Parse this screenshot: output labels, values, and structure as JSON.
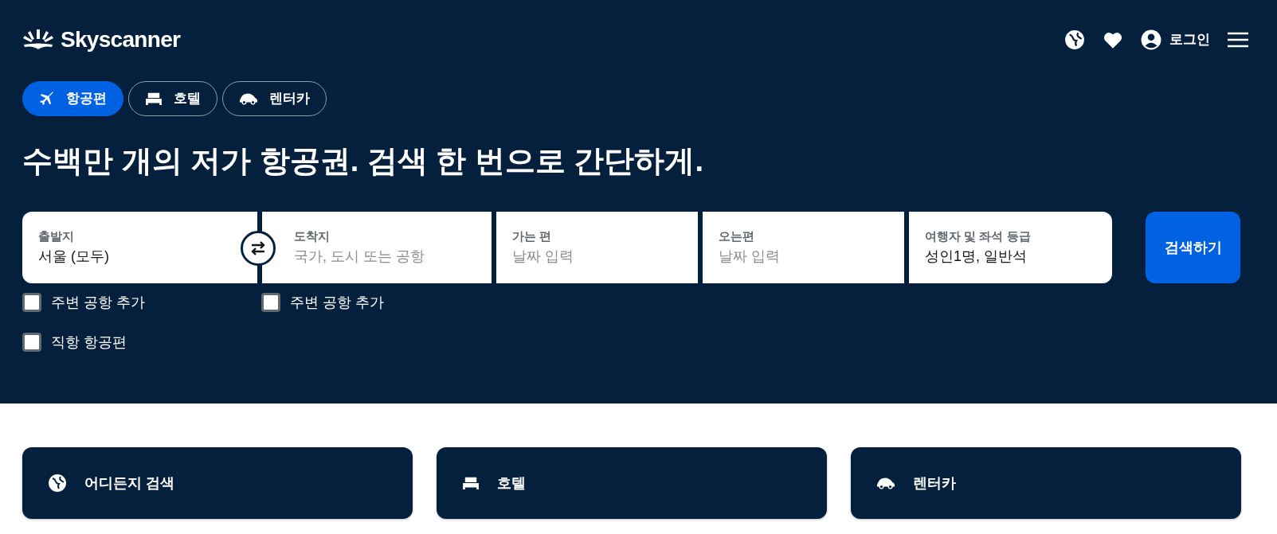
{
  "header": {
    "logo": "Skyscanner",
    "login": "로그인"
  },
  "tabs": [
    {
      "label": "항공편",
      "kind": "plane",
      "selected": true
    },
    {
      "label": "호텔",
      "kind": "bed",
      "selected": false
    },
    {
      "label": "렌터카",
      "kind": "car",
      "selected": false
    }
  ],
  "headline": "수백만 개의 저가 항공권. 검색 한 번으로 간단하게.",
  "search_fields": [
    {
      "label": "출발지",
      "value": "서울 (모두)"
    },
    {
      "label": "도착지",
      "placeholder": "국가, 도시 또는 공항"
    },
    {
      "label": "가는 편",
      "placeholder": "날짜 입력"
    },
    {
      "label": "오는편",
      "placeholder": "날짜 입력"
    },
    {
      "label": "여행자 및 좌석 등급",
      "value": "성인1명, 일반석"
    }
  ],
  "search_button": "검색하기",
  "options": [
    {
      "label": "주변 공항 추가",
      "checked": false
    },
    {
      "label": "주변 공항 추가",
      "checked": false
    },
    {
      "label": "직항 항공편",
      "checked": false
    }
  ],
  "cards": [
    {
      "label": "어디든지 검색",
      "kind": "globe"
    },
    {
      "label": "호텔",
      "kind": "bed"
    },
    {
      "label": "렌터카",
      "kind": "car"
    }
  ]
}
